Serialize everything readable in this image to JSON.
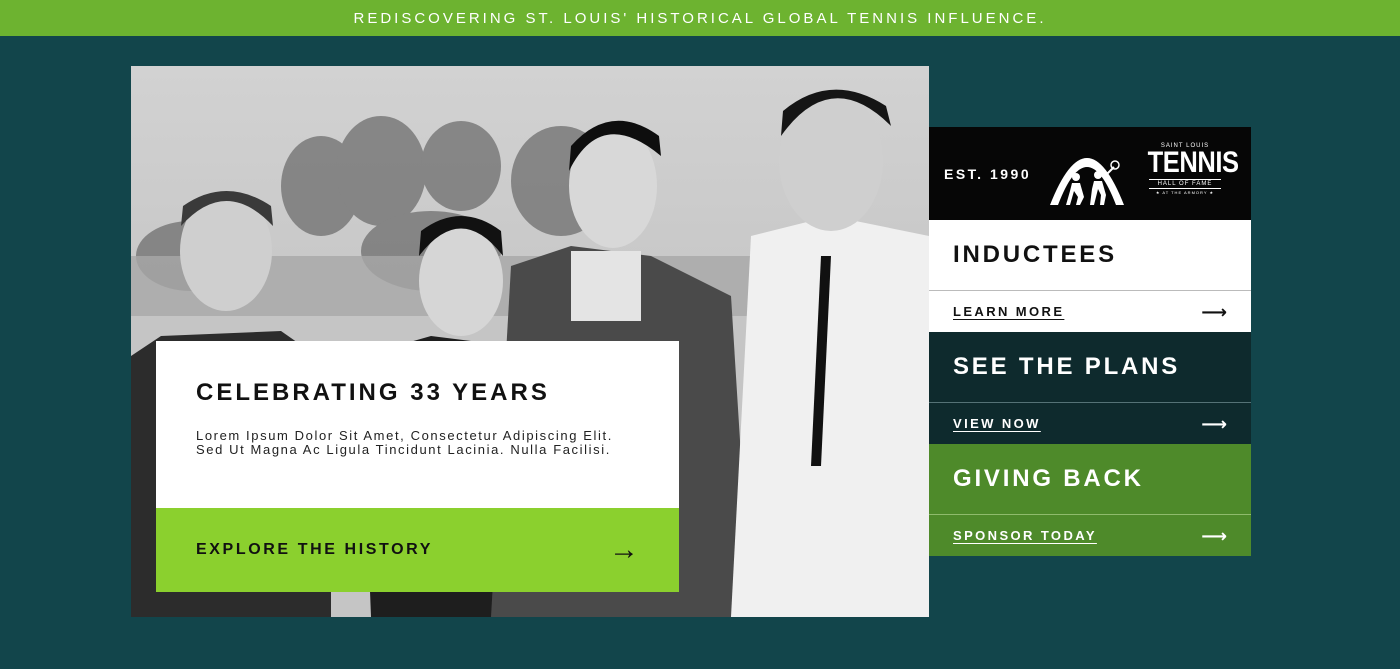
{
  "banner": {
    "text": "REDISCOVERING ST. LOUIS' HISTORICAL GLOBAL TENNIS INFLUENCE."
  },
  "hero": {
    "image_description": "black-and-white-photo-four-men"
  },
  "card": {
    "title": "CELEBRATING 33 YEARS",
    "body": "Lorem Ipsum Dolor Sit Amet, Consectetur Adipiscing Elit. Sed Ut Magna Ac Ligula Tincidunt Lacinia. Nulla Facilisi.",
    "cta_label": "EXPLORE THE HISTORY",
    "cta_icon": "arrow-right-icon"
  },
  "logo": {
    "est": "EST. 1990",
    "line1": "SAINT LOUIS",
    "line2": "TENNIS",
    "line3": "HALL OF FAME",
    "line4": "★ AT THE ARMORY ★"
  },
  "panels": [
    {
      "title": "INDUCTEES",
      "link": "LEARN MORE",
      "icon": "arrow-right-icon",
      "color": "#ffffff"
    },
    {
      "title": "SEE THE PLANS",
      "link": "VIEW NOW",
      "icon": "arrow-right-icon",
      "color": "#0e2a2d"
    },
    {
      "title": "GIVING BACK",
      "link": "SPONSOR TODAY",
      "icon": "arrow-right-icon",
      "color": "#4e8a2a"
    }
  ],
  "colors": {
    "background": "#12454b",
    "banner": "#6db330",
    "cta": "#8bd02e",
    "logo_bg": "#060606"
  }
}
